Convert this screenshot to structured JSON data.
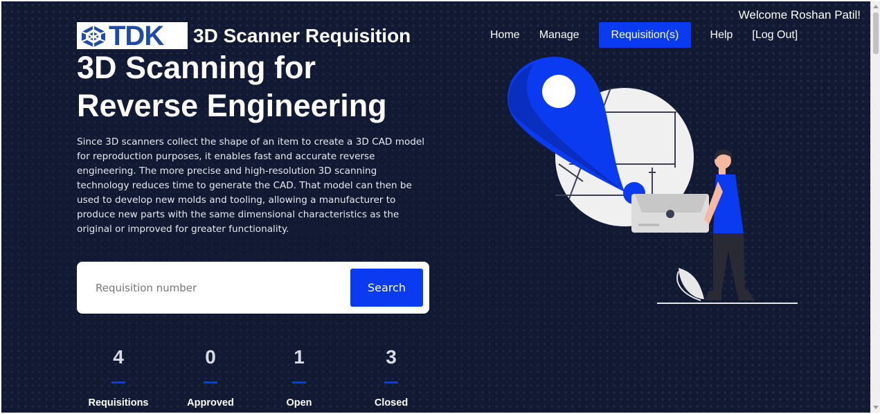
{
  "header": {
    "welcome": "Welcome Roshan Patil!",
    "logo_text": "TDK",
    "app_title": "3D Scanner Requisition"
  },
  "nav": {
    "home": "Home",
    "manage": "Manage",
    "requisitions": "Requisition(s)",
    "help": "Help",
    "logout": "[Log Out]"
  },
  "hero": {
    "title_line1": "3D Scanning for",
    "title_line2": "Reverse Engineering",
    "description": "Since 3D scanners collect the shape of an item to create a 3D CAD model for reproduction purposes, it enables fast and accurate reverse engineering. The more precise and high-resolution 3D scanning technology reduces time to generate the CAD. That model can then be used to develop new molds and tooling, allowing a manufacturer to produce new parts with the same dimensional characteristics as the original or improved for greater functionality."
  },
  "search": {
    "placeholder": "Requisition number",
    "button": "Search"
  },
  "stats": [
    {
      "value": "4",
      "label": "Requisitions"
    },
    {
      "value": "0",
      "label": "Approved"
    },
    {
      "value": "1",
      "label": "Open"
    },
    {
      "value": "3",
      "label": "Closed"
    }
  ],
  "colors": {
    "background": "#121a33",
    "accent": "#0b3bf0",
    "brand_blue": "#1f4aa8"
  },
  "icons": {
    "logo": "tdk-logo-icon",
    "illustration": "location-pin-scanner-illustration"
  }
}
